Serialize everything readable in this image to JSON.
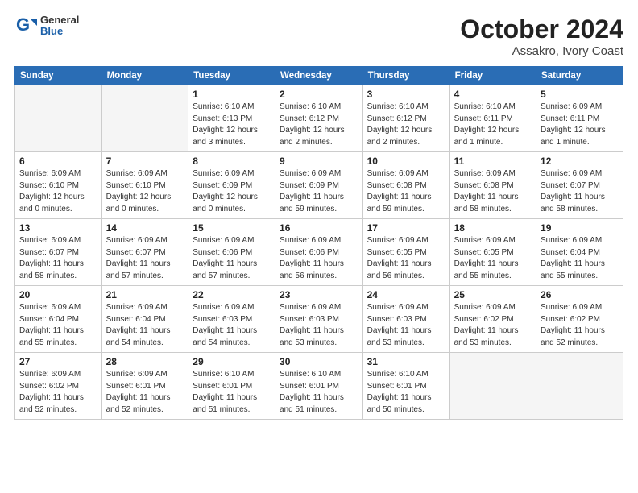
{
  "header": {
    "logo_general": "General",
    "logo_blue": "Blue",
    "month_year": "October 2024",
    "location": "Assakro, Ivory Coast"
  },
  "weekdays": [
    "Sunday",
    "Monday",
    "Tuesday",
    "Wednesday",
    "Thursday",
    "Friday",
    "Saturday"
  ],
  "weeks": [
    [
      {
        "day": "",
        "info": ""
      },
      {
        "day": "",
        "info": ""
      },
      {
        "day": "1",
        "info": "Sunrise: 6:10 AM\nSunset: 6:13 PM\nDaylight: 12 hours\nand 3 minutes."
      },
      {
        "day": "2",
        "info": "Sunrise: 6:10 AM\nSunset: 6:12 PM\nDaylight: 12 hours\nand 2 minutes."
      },
      {
        "day": "3",
        "info": "Sunrise: 6:10 AM\nSunset: 6:12 PM\nDaylight: 12 hours\nand 2 minutes."
      },
      {
        "day": "4",
        "info": "Sunrise: 6:10 AM\nSunset: 6:11 PM\nDaylight: 12 hours\nand 1 minute."
      },
      {
        "day": "5",
        "info": "Sunrise: 6:09 AM\nSunset: 6:11 PM\nDaylight: 12 hours\nand 1 minute."
      }
    ],
    [
      {
        "day": "6",
        "info": "Sunrise: 6:09 AM\nSunset: 6:10 PM\nDaylight: 12 hours\nand 0 minutes."
      },
      {
        "day": "7",
        "info": "Sunrise: 6:09 AM\nSunset: 6:10 PM\nDaylight: 12 hours\nand 0 minutes."
      },
      {
        "day": "8",
        "info": "Sunrise: 6:09 AM\nSunset: 6:09 PM\nDaylight: 12 hours\nand 0 minutes."
      },
      {
        "day": "9",
        "info": "Sunrise: 6:09 AM\nSunset: 6:09 PM\nDaylight: 11 hours\nand 59 minutes."
      },
      {
        "day": "10",
        "info": "Sunrise: 6:09 AM\nSunset: 6:08 PM\nDaylight: 11 hours\nand 59 minutes."
      },
      {
        "day": "11",
        "info": "Sunrise: 6:09 AM\nSunset: 6:08 PM\nDaylight: 11 hours\nand 58 minutes."
      },
      {
        "day": "12",
        "info": "Sunrise: 6:09 AM\nSunset: 6:07 PM\nDaylight: 11 hours\nand 58 minutes."
      }
    ],
    [
      {
        "day": "13",
        "info": "Sunrise: 6:09 AM\nSunset: 6:07 PM\nDaylight: 11 hours\nand 58 minutes."
      },
      {
        "day": "14",
        "info": "Sunrise: 6:09 AM\nSunset: 6:07 PM\nDaylight: 11 hours\nand 57 minutes."
      },
      {
        "day": "15",
        "info": "Sunrise: 6:09 AM\nSunset: 6:06 PM\nDaylight: 11 hours\nand 57 minutes."
      },
      {
        "day": "16",
        "info": "Sunrise: 6:09 AM\nSunset: 6:06 PM\nDaylight: 11 hours\nand 56 minutes."
      },
      {
        "day": "17",
        "info": "Sunrise: 6:09 AM\nSunset: 6:05 PM\nDaylight: 11 hours\nand 56 minutes."
      },
      {
        "day": "18",
        "info": "Sunrise: 6:09 AM\nSunset: 6:05 PM\nDaylight: 11 hours\nand 55 minutes."
      },
      {
        "day": "19",
        "info": "Sunrise: 6:09 AM\nSunset: 6:04 PM\nDaylight: 11 hours\nand 55 minutes."
      }
    ],
    [
      {
        "day": "20",
        "info": "Sunrise: 6:09 AM\nSunset: 6:04 PM\nDaylight: 11 hours\nand 55 minutes."
      },
      {
        "day": "21",
        "info": "Sunrise: 6:09 AM\nSunset: 6:04 PM\nDaylight: 11 hours\nand 54 minutes."
      },
      {
        "day": "22",
        "info": "Sunrise: 6:09 AM\nSunset: 6:03 PM\nDaylight: 11 hours\nand 54 minutes."
      },
      {
        "day": "23",
        "info": "Sunrise: 6:09 AM\nSunset: 6:03 PM\nDaylight: 11 hours\nand 53 minutes."
      },
      {
        "day": "24",
        "info": "Sunrise: 6:09 AM\nSunset: 6:03 PM\nDaylight: 11 hours\nand 53 minutes."
      },
      {
        "day": "25",
        "info": "Sunrise: 6:09 AM\nSunset: 6:02 PM\nDaylight: 11 hours\nand 53 minutes."
      },
      {
        "day": "26",
        "info": "Sunrise: 6:09 AM\nSunset: 6:02 PM\nDaylight: 11 hours\nand 52 minutes."
      }
    ],
    [
      {
        "day": "27",
        "info": "Sunrise: 6:09 AM\nSunset: 6:02 PM\nDaylight: 11 hours\nand 52 minutes."
      },
      {
        "day": "28",
        "info": "Sunrise: 6:09 AM\nSunset: 6:01 PM\nDaylight: 11 hours\nand 52 minutes."
      },
      {
        "day": "29",
        "info": "Sunrise: 6:10 AM\nSunset: 6:01 PM\nDaylight: 11 hours\nand 51 minutes."
      },
      {
        "day": "30",
        "info": "Sunrise: 6:10 AM\nSunset: 6:01 PM\nDaylight: 11 hours\nand 51 minutes."
      },
      {
        "day": "31",
        "info": "Sunrise: 6:10 AM\nSunset: 6:01 PM\nDaylight: 11 hours\nand 50 minutes."
      },
      {
        "day": "",
        "info": ""
      },
      {
        "day": "",
        "info": ""
      }
    ]
  ]
}
